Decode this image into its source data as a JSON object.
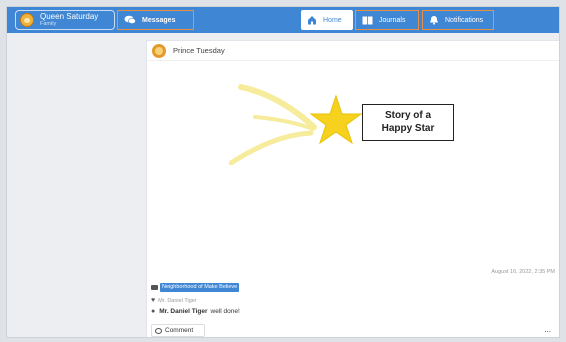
{
  "profile": {
    "name": "Queen Saturday",
    "subtitle": "Family"
  },
  "nav": {
    "messages": "Messages",
    "home": "Home",
    "journals": "Journals",
    "notifications": "Notifications"
  },
  "post": {
    "author": "Prince Tuesday",
    "image_text": [
      "Story of a",
      "Happy Star"
    ],
    "date": "August 16, 2022, 2:35 PM",
    "tag": "Neighborhood of Make Believe",
    "liked_by": "Mr. Daniel Tiger",
    "comment": {
      "author": "Mr. Daniel Tiger",
      "text": "well done!"
    },
    "comment_button": "Comment",
    "more": "..."
  },
  "colors": {
    "accent": "#3f86d4",
    "highlight_border": "#e59148"
  }
}
